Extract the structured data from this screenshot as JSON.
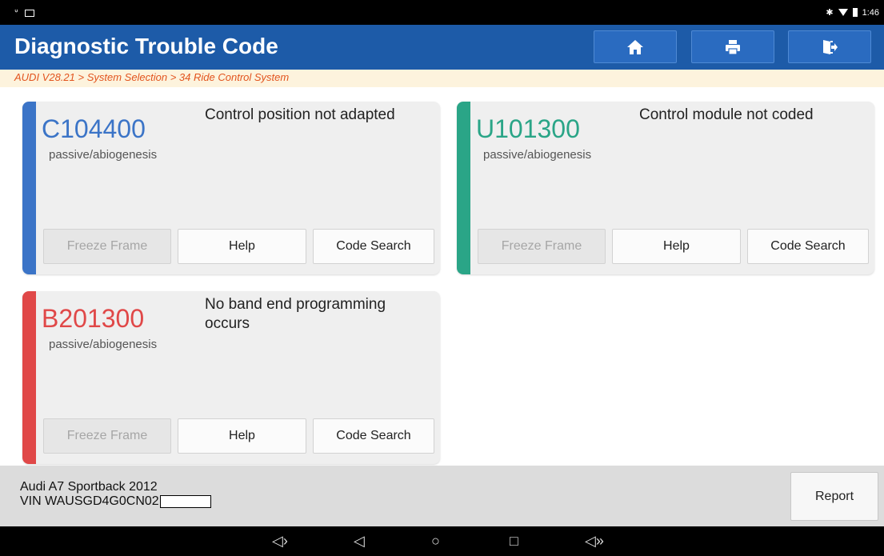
{
  "header": {
    "title": "Diagnostic Trouble Code",
    "home_icon": "home-icon",
    "print_icon": "printer-icon",
    "exit_icon": "exit-icon"
  },
  "breadcrumb": "AUDI V28.21 > System Selection > 34 Ride Control System",
  "status_bar": {
    "time": "1:46"
  },
  "dtcs": [
    {
      "code": "C104400",
      "status": "passive/abiogenesis",
      "description": "Control position not adapted",
      "color": "#3b74c7"
    },
    {
      "code": "U101300",
      "status": "passive/abiogenesis",
      "description": "Control module not coded",
      "color": "#2aa587"
    },
    {
      "code": "B201300",
      "status": "passive/abiogenesis",
      "description": "No band end programming occurs",
      "color": "#e04848"
    }
  ],
  "buttons": {
    "freeze_frame": "Freeze Frame",
    "help": "Help",
    "code_search": "Code Search",
    "report": "Report"
  },
  "vehicle": {
    "model": "Audi A7 Sportback 2012",
    "vin": "VIN WAUSGD4G0CN02"
  },
  "nav": {
    "volume_down": "◁›",
    "back": "◁",
    "home": "○",
    "recents": "□",
    "volume_up": "◁»"
  }
}
